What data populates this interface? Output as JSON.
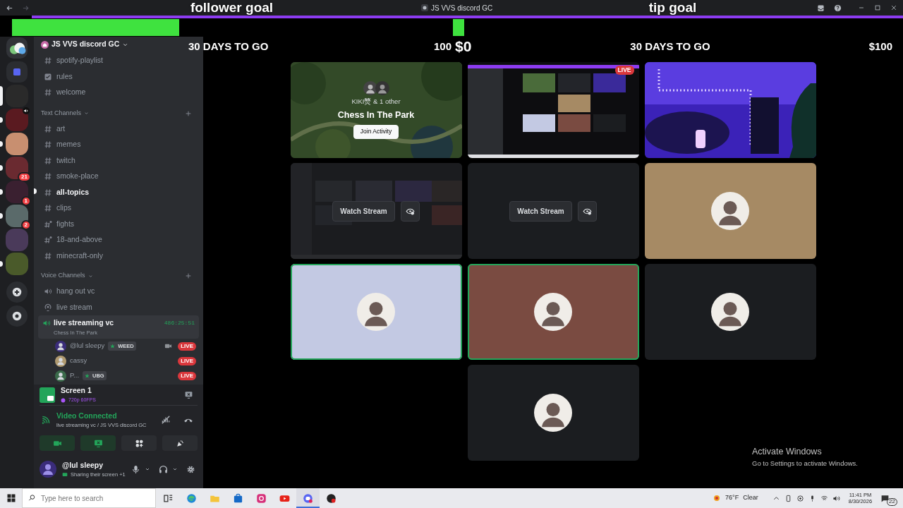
{
  "titlebar": {
    "title": "JS VVS discord GC"
  },
  "goals": [
    {
      "title": "follower goal",
      "level": 0.38,
      "days_left": "30 DAYS TO GO",
      "target": "100"
    },
    {
      "title": "tip goal",
      "level": 0.025,
      "current": "$0",
      "days_left": "30 DAYS TO GO",
      "target": "$100"
    }
  ],
  "servers": [
    {
      "kind": "home",
      "selected": false,
      "unread": false
    },
    {
      "kind": "folder",
      "selected": false,
      "unread": false
    },
    {
      "kind": "server",
      "selected": true,
      "unread": false
    },
    {
      "kind": "server",
      "selected": false,
      "unread": true,
      "voice": true
    },
    {
      "kind": "server",
      "selected": false,
      "unread": true
    },
    {
      "kind": "server",
      "selected": false,
      "unread": true,
      "badge": "21"
    },
    {
      "kind": "server",
      "selected": false,
      "unread": true,
      "badge": "1"
    },
    {
      "kind": "server",
      "selected": false,
      "unread": true,
      "badge": "2"
    },
    {
      "kind": "server",
      "selected": false,
      "unread": false
    },
    {
      "kind": "server",
      "selected": false,
      "unread": true
    },
    {
      "kind": "add",
      "selected": false,
      "unread": false
    },
    {
      "kind": "discover",
      "selected": false,
      "unread": false
    }
  ],
  "server_name": "JS VVS discord GC",
  "channels": [
    {
      "kind": "text",
      "name": "spotify-playlist",
      "unread": false
    },
    {
      "kind": "rules",
      "name": "rules",
      "unread": false
    },
    {
      "kind": "text",
      "name": "welcome",
      "unread": false
    }
  ],
  "categories": [
    {
      "name": "Text Channels",
      "channels": [
        {
          "kind": "text",
          "name": "art",
          "unread": false
        },
        {
          "kind": "text",
          "name": "memes",
          "unread": false
        },
        {
          "kind": "text",
          "name": "twitch",
          "unread": false
        },
        {
          "kind": "text",
          "name": "smoke-place",
          "unread": false
        },
        {
          "kind": "text",
          "name": "all-topics",
          "unread": true
        },
        {
          "kind": "text",
          "name": "clips",
          "unread": false
        },
        {
          "kind": "restricted",
          "name": "fights",
          "unread": false
        },
        {
          "kind": "restricted",
          "name": "18-and-above",
          "unread": false
        },
        {
          "kind": "text",
          "name": "minecraft-only",
          "unread": false
        }
      ]
    },
    {
      "name": "Voice Channels",
      "channels": [
        {
          "kind": "voice",
          "name": "hang out vc",
          "connected": false
        },
        {
          "kind": "stage",
          "name": "live stream",
          "connected": false
        },
        {
          "kind": "voice",
          "name": "live streaming vc",
          "connected": true,
          "activity": "Chess In The Park",
          "timer": "486:25:51",
          "members": [
            {
              "name": "@lul sleepy",
              "tag": "WEED",
              "camera": true,
              "badge": "LIVE"
            },
            {
              "name": "cassy",
              "camera": false,
              "badge": "LIVE"
            },
            {
              "name": "P...",
              "tag": "UBG",
              "camera": false,
              "badge": "LIVE"
            }
          ]
        }
      ]
    }
  ],
  "stream_panel": {
    "title": "Screen 1",
    "quality": "720p 60FPS"
  },
  "connection": {
    "status": "Video Connected",
    "location": "live streaming vc / JS VVS discord GC"
  },
  "controls": [
    {
      "kind": "camera",
      "on": true
    },
    {
      "kind": "screen",
      "on": true
    },
    {
      "kind": "activities",
      "on": false
    },
    {
      "kind": "soundboard",
      "on": false
    }
  ],
  "user": {
    "name": "@lul sleepy",
    "status": "Sharing their screen +1"
  },
  "tiles": [
    {
      "kind": "activity",
      "users": "KIKI燹 & 1 other",
      "title": "Chess In The Park",
      "button": "Join Activity"
    },
    {
      "kind": "stream",
      "badge": "LIVE"
    },
    {
      "kind": "camera"
    },
    {
      "kind": "hidden_stream",
      "button": "Watch Stream",
      "blurred": true
    },
    {
      "kind": "hidden_stream",
      "button": "Watch Stream",
      "blurred": false
    },
    {
      "kind": "avatar",
      "color": "#a68a64",
      "speaking": false
    },
    {
      "kind": "avatar",
      "color": "#c3c9e3",
      "speaking": true
    },
    {
      "kind": "avatar",
      "color": "#7a4b41",
      "speaking": true
    },
    {
      "kind": "avatar",
      "color": "#1b1d20",
      "speaking": false
    },
    {
      "kind": "avatar",
      "color": "#1b1d20",
      "speaking": false
    }
  ],
  "windows_notice": {
    "title": "Activate Windows",
    "text": "Go to Settings to activate Windows."
  },
  "taskbar": {
    "search_placeholder": "Type here to search",
    "apps": [
      {
        "kind": "taskview",
        "selected": false
      },
      {
        "kind": "edge",
        "selected": false
      },
      {
        "kind": "explorer",
        "selected": false
      },
      {
        "kind": "store",
        "selected": false
      },
      {
        "kind": "instagram",
        "selected": false
      },
      {
        "kind": "youtube",
        "selected": false
      },
      {
        "kind": "discord",
        "selected": true
      },
      {
        "kind": "app",
        "selected": false
      }
    ],
    "temperature": "76°F",
    "weather": "Clear",
    "time": "11:41 PM",
    "date": "8/30/2026",
    "notifications": "22"
  }
}
